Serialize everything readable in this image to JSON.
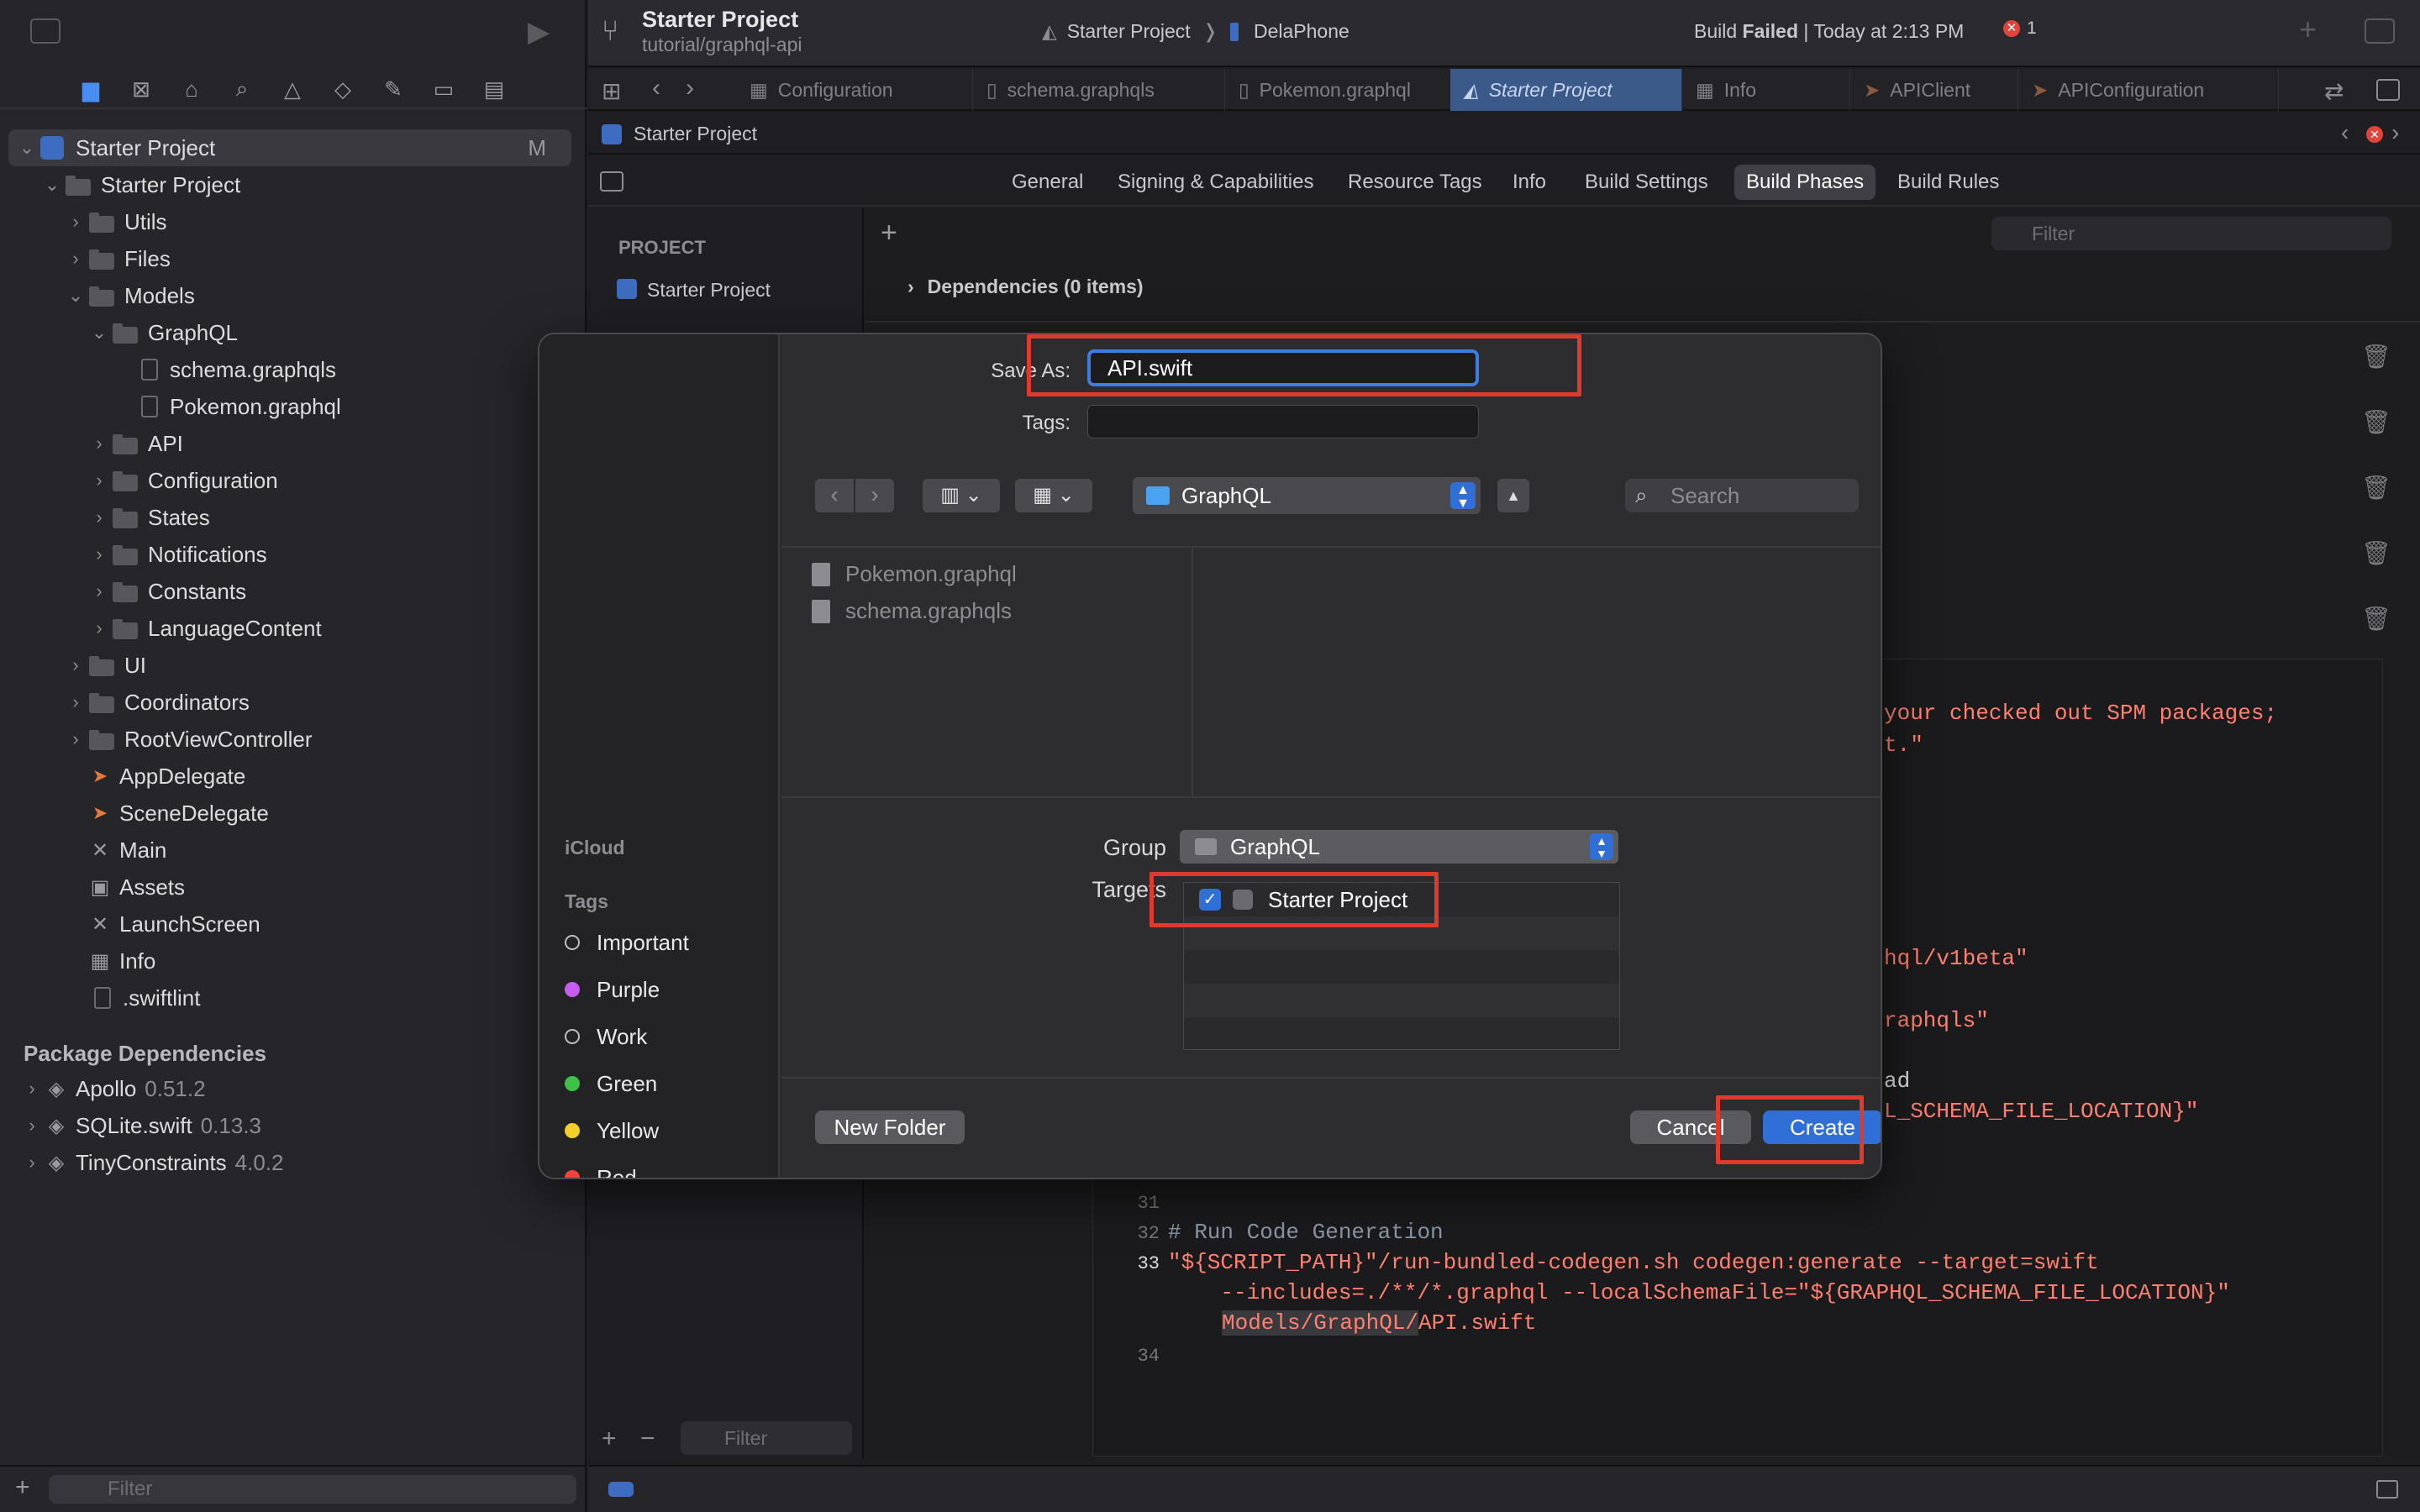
{
  "navigator": {
    "root_item": "Starter Project",
    "root_badge": "M",
    "tree": [
      {
        "label": "Starter Project",
        "disclosure": "open"
      },
      {
        "label": "Utils",
        "disclosure": "closed"
      },
      {
        "label": "Files",
        "disclosure": "closed"
      },
      {
        "label": "Models",
        "disclosure": "open"
      },
      {
        "label": "GraphQL",
        "disclosure": "open"
      },
      {
        "label": "schema.graphqls"
      },
      {
        "label": "Pokemon.graphql"
      },
      {
        "label": "API",
        "disclosure": "closed"
      },
      {
        "label": "Configuration",
        "disclosure": "closed"
      },
      {
        "label": "States",
        "disclosure": "closed"
      },
      {
        "label": "Notifications",
        "disclosure": "closed"
      },
      {
        "label": "Constants",
        "disclosure": "closed"
      },
      {
        "label": "LanguageContent",
        "disclosure": "closed"
      },
      {
        "label": "UI",
        "disclosure": "closed"
      },
      {
        "label": "Coordinators",
        "disclosure": "closed"
      },
      {
        "label": "RootViewController",
        "disclosure": "closed"
      },
      {
        "label": "AppDelegate"
      },
      {
        "label": "SceneDelegate"
      },
      {
        "label": "Main"
      },
      {
        "label": "Assets"
      },
      {
        "label": "LaunchScreen"
      },
      {
        "label": "Info"
      },
      {
        "label": ".swiftlint"
      }
    ],
    "package_header": "Package Dependencies",
    "packages": [
      {
        "name": "Apollo",
        "version": "0.51.2"
      },
      {
        "name": "SQLite.swift",
        "version": "0.13.3"
      },
      {
        "name": "TinyConstraints",
        "version": "4.0.2"
      }
    ],
    "filter_placeholder": "Filter"
  },
  "toolbar": {
    "project_title": "Starter Project",
    "branch": "tutorial/graphql-api",
    "scheme": "Starter Project",
    "device": "DelaPhone",
    "status_prefix": "Build ",
    "status_strong": "Failed",
    "status_suffix": " | Today at 2:13 PM",
    "error_count": "1"
  },
  "tabs": [
    {
      "label": "Configuration"
    },
    {
      "label": "schema.graphqls"
    },
    {
      "label": "Pokemon.graphql"
    },
    {
      "label": "Starter Project",
      "active": true
    },
    {
      "label": "Info"
    },
    {
      "label": "APIClient"
    },
    {
      "label": "APIConfiguration"
    }
  ],
  "breadcrumb": "Starter Project",
  "settings_tabs": [
    "General",
    "Signing & Capabilities",
    "Resource Tags",
    "Info",
    "Build Settings",
    "Build Phases",
    "Build Rules"
  ],
  "active_settings_tab": "Build Phases",
  "filter_placeholder": "Filter",
  "project_panel": {
    "header": "PROJECT",
    "item": "Starter Project"
  },
  "phases": {
    "dependencies": "Dependencies (0 items)"
  },
  "code": {
    "line_partials": [
      "your checked out SPM packages;",
      "t.\"",
      "hql/v1beta\"",
      "raphqls\"",
      "ad",
      "L_SCHEMA_FILE_LOCATION}\""
    ],
    "line_numbers": [
      "31",
      "32",
      "33",
      "34"
    ],
    "comment": "# Run Code Generation",
    "line33": "\"${SCRIPT_PATH}\"/run-bundled-codegen.sh codegen:generate --target=swift",
    "line33b": "    --includes=./**/*.graphql --localSchemaFile=\"${GRAPHQL_SCHEMA_FILE_LOCATION}\"",
    "line33c_highlight": "Models/GraphQL/",
    "line33c_rest": "API.swift"
  },
  "dialog": {
    "save_as_label": "Save As:",
    "save_as_value": "API.swift",
    "tags_label": "Tags:",
    "location": "GraphQL",
    "search_placeholder": "Search",
    "files": [
      "Pokemon.graphql",
      "schema.graphqls"
    ],
    "sidebar": {
      "icloud": "iCloud",
      "tags_header": "Tags",
      "tags": [
        {
          "label": "Important",
          "color": "#00000000"
        },
        {
          "label": "Purple",
          "color": "#c75cf0"
        },
        {
          "label": "Work",
          "color": "#00000000"
        },
        {
          "label": "Green",
          "color": "#3fc24a"
        },
        {
          "label": "Yellow",
          "color": "#f3cf2a"
        },
        {
          "label": "Red",
          "color": "#f0443a"
        }
      ]
    },
    "group_label": "Group",
    "group_value": "GraphQL",
    "targets_label": "Targets",
    "target_name": "Starter Project",
    "target_checked": true,
    "new_folder": "New Folder",
    "cancel": "Cancel",
    "create": "Create"
  },
  "colors": {
    "accent": "#2f6fd6",
    "highlight_box": "#e03a2e"
  }
}
